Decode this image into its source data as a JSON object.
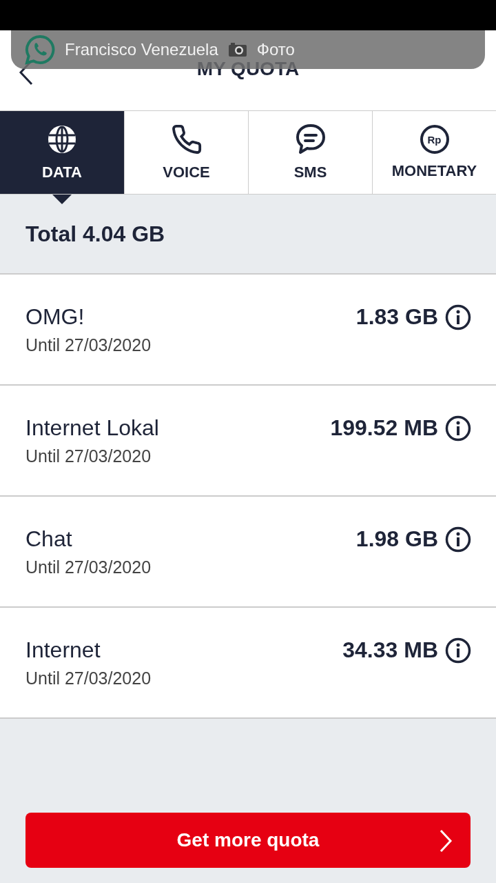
{
  "notification": {
    "sender": "Francisco Venezuela",
    "message": "Фото"
  },
  "header": {
    "title": "MY QUOTA"
  },
  "tabs": [
    {
      "label": "DATA",
      "kind": "globe",
      "selected": true
    },
    {
      "label": "VOICE",
      "kind": "phone",
      "selected": false
    },
    {
      "label": "SMS",
      "kind": "chat",
      "selected": false
    },
    {
      "label": "MONETARY",
      "kind": "currency",
      "icon_text": "Rp",
      "selected": false
    }
  ],
  "total": "Total 4.04 GB",
  "quotas": [
    {
      "name": "OMG!",
      "until": "Until 27/03/2020",
      "amount": "1.83 GB"
    },
    {
      "name": "Internet Lokal",
      "until": "Until 27/03/2020",
      "amount": "199.52 MB"
    },
    {
      "name": "Chat",
      "until": "Until 27/03/2020",
      "amount": "1.98 GB"
    },
    {
      "name": "Internet",
      "until": "Until 27/03/2020",
      "amount": "34.33 MB"
    }
  ],
  "button": {
    "label": "Get more quota"
  }
}
